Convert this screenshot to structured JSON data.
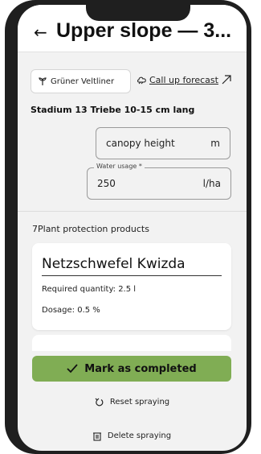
{
  "header": {
    "back_icon": "←",
    "title": "Upper slope — 3..."
  },
  "variety_chip": {
    "icon": "grape-leaf-icon",
    "label": "Grüner Veltliner"
  },
  "forecast": {
    "label": "Call up forecast",
    "icon": "arrow-up-right-icon"
  },
  "stage": "Stadium 13 Triebe 10-15 cm lang",
  "fields": {
    "canopy": {
      "value": "canopy height",
      "unit": "m"
    },
    "water": {
      "legend": "Water usage *",
      "value": "250",
      "unit": "l/ha"
    }
  },
  "section_title": "7Plant protection products",
  "product": {
    "name": "Netzschwefel Kwizda",
    "quantity": "Required quantity: 2.5 l",
    "dosage": "Dosage: 0.5 %"
  },
  "actions": {
    "complete": "Mark as completed",
    "reset": "Reset spraying",
    "delete": "Delete spraying"
  }
}
